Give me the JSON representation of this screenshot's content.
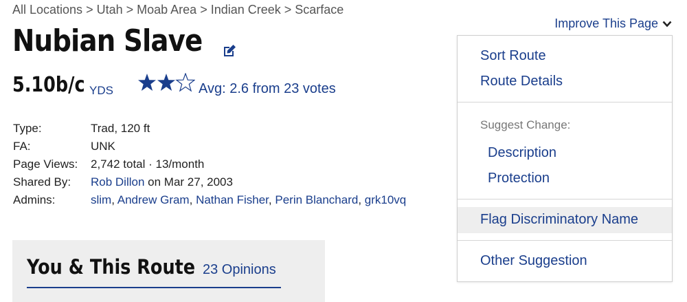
{
  "breadcrumb": {
    "items": [
      "All Locations",
      "Utah",
      "Moab Area",
      "Indian Creek",
      "Scarface"
    ],
    "separator": ">"
  },
  "route": {
    "name": "Nubian Slave",
    "grade": "5.10b/c",
    "grade_system": "YDS",
    "rating_text": "Avg: 2.6 from 23 votes",
    "stars": 2.6
  },
  "info": {
    "type_label": "Type:",
    "type_value": "Trad, 120 ft",
    "fa_label": "FA:",
    "fa_value": "UNK",
    "views_label": "Page Views:",
    "views_value": "2,742 total · 13/month",
    "shared_label": "Shared By:",
    "shared_by": "Rob Dillon",
    "shared_date": " on Mar 27, 2003",
    "admins_label": "Admins:",
    "admins": [
      "slim",
      "Andrew Gram",
      "Nathan Fisher",
      "Perin Blanchard",
      "grk10vq"
    ]
  },
  "you_section": {
    "title": "You & This Route",
    "opinions": "23 Opinions"
  },
  "improve": {
    "label": "Improve This Page",
    "menu": {
      "sort_route": "Sort Route",
      "route_details": "Route Details",
      "suggest_heading": "Suggest Change:",
      "description": "Description",
      "protection": "Protection",
      "flag": "Flag Discriminatory Name",
      "other": "Other Suggestion"
    }
  },
  "colors": {
    "link": "#1a3e8c",
    "star": "#1a3e8c",
    "panel": "#eeeeee"
  }
}
